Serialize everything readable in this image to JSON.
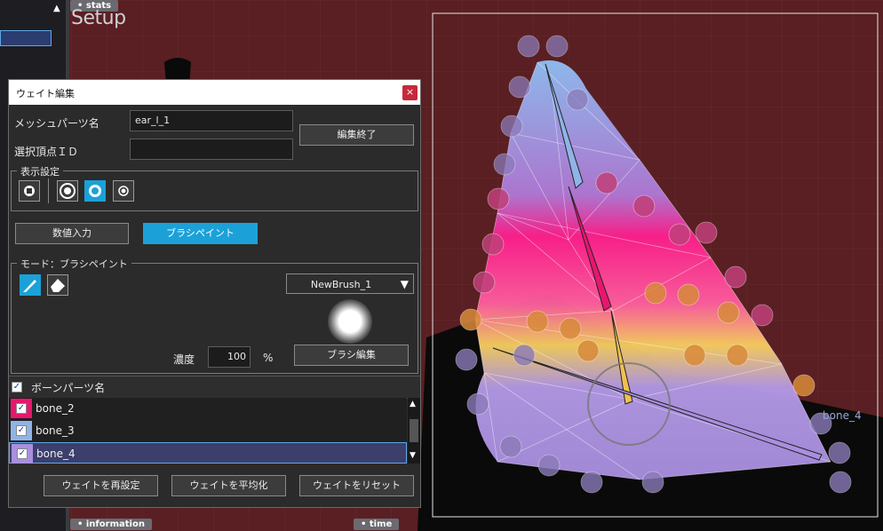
{
  "app": {
    "mode_title": "Setup",
    "top_tag": "stats",
    "bottom_tags": {
      "information": "information",
      "time": "time"
    },
    "viewport_bone_label": "bone_4"
  },
  "dialog": {
    "title": "ウェイト編集",
    "close_glyph": "×",
    "mesh_part_label": "メッシュパーツ名",
    "mesh_part_value": "ear_l_1",
    "selected_vertex_label": "選択頂点ＩＤ",
    "selected_vertex_value": "",
    "end_edit_label": "編集終了",
    "display_settings_legend": "表示設定",
    "display_icons": [
      "vertex-square-icon",
      "vertex-ring-icon",
      "vertex-ring-filled-icon",
      "vertex-dot-icon"
    ],
    "input_mode_tabs": [
      {
        "label": "数値入力",
        "active": false
      },
      {
        "label": "ブラシペイント",
        "active": true
      }
    ],
    "mode_legend": "モード：ブラシペイント",
    "tool_icons": [
      "brush-icon",
      "eraser-icon"
    ],
    "brush_select": {
      "value": "NewBrush_1",
      "caret": "▼"
    },
    "density_label": "濃度",
    "density_value": "100",
    "density_unit": "%",
    "brush_edit_label": "ブラシ編集",
    "bone_header_label": "ボーンパーツ名",
    "bones": [
      {
        "name": "bone_2",
        "color": "#e8166e",
        "checked": true,
        "selected": false
      },
      {
        "name": "bone_3",
        "color": "#8fb4e8",
        "checked": true,
        "selected": false
      },
      {
        "name": "bone_4",
        "color": "#a98fe0",
        "checked": true,
        "selected": true
      }
    ],
    "actions": [
      "ウェイトを再設定",
      "ウェイトを平均化",
      "ウェイトをリセット"
    ],
    "check_glyph": "✓",
    "scroll_up": "▲",
    "scroll_down": "▼"
  }
}
